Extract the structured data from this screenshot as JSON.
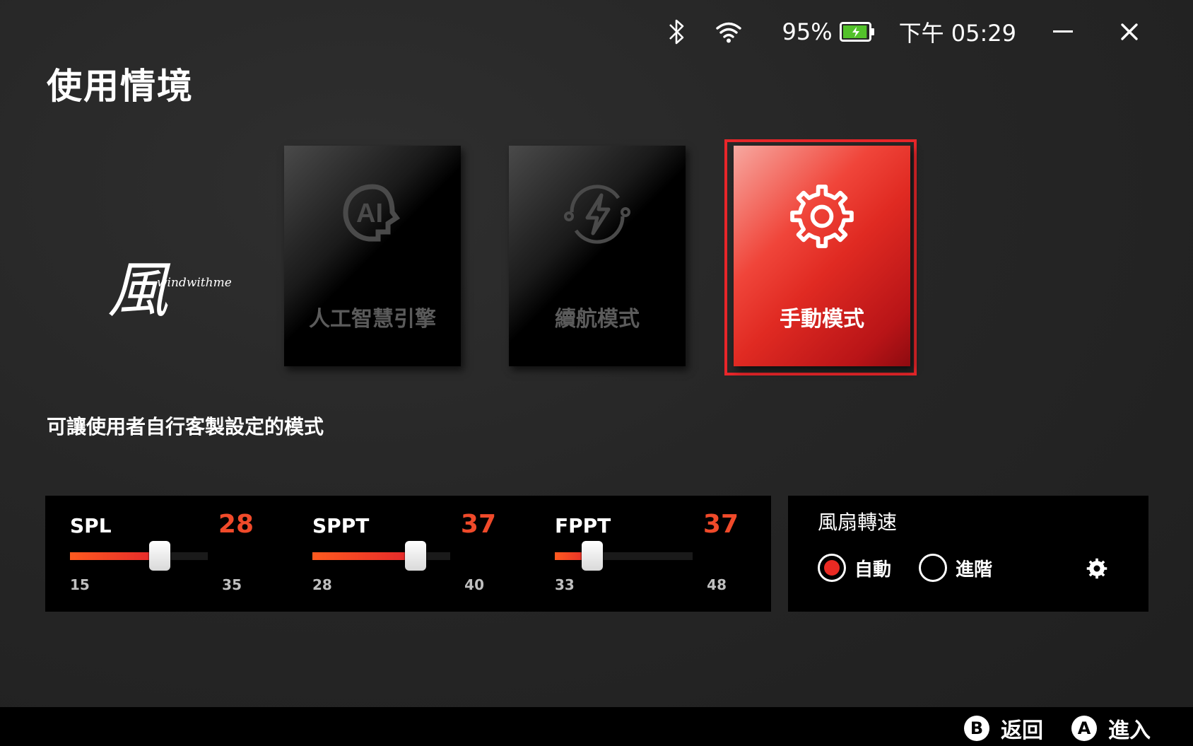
{
  "status": {
    "battery_percent": "95%",
    "battery_level": 0.95,
    "time": "下午 05:29",
    "icons": [
      "bluetooth-icon",
      "wifi-icon",
      "battery-icon"
    ]
  },
  "page": {
    "title": "使用情境"
  },
  "watermark": {
    "glyph": "風",
    "text": "windwithme"
  },
  "modes": [
    {
      "label": "人工智慧引擎",
      "icon": "ai-icon",
      "selected": false
    },
    {
      "label": "續航模式",
      "icon": "battery-saver-icon",
      "selected": false
    },
    {
      "label": "手動模式",
      "icon": "gear-icon",
      "selected": true
    }
  ],
  "description": "可讓使用者自行客製設定的模式",
  "sliders": [
    {
      "name": "SPL",
      "value": "28",
      "min": "15",
      "max": "35",
      "fraction": 0.65
    },
    {
      "name": "SPPT",
      "value": "37",
      "min": "28",
      "max": "40",
      "fraction": 0.75
    },
    {
      "name": "FPPT",
      "value": "37",
      "min": "33",
      "max": "48",
      "fraction": 0.27
    }
  ],
  "fan": {
    "title": "風扇轉速",
    "options": [
      {
        "label": "自動",
        "selected": true
      },
      {
        "label": "進階",
        "selected": false
      }
    ]
  },
  "footer": {
    "back": {
      "key": "B",
      "label": "返回"
    },
    "enter": {
      "key": "A",
      "label": "進入"
    }
  },
  "colors": {
    "accent": "#e8262a",
    "value": "#f04a2a"
  }
}
